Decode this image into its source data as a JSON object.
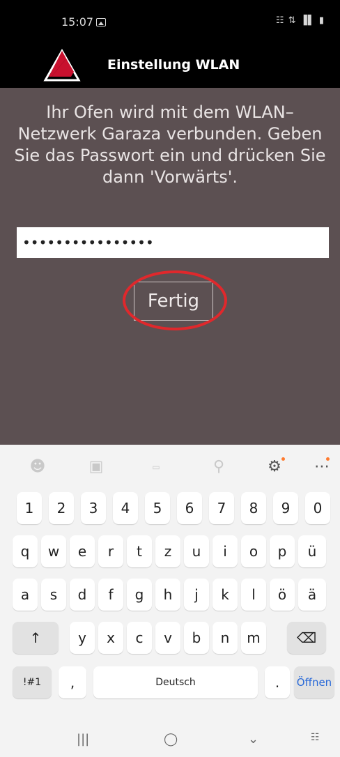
{
  "status_bar": {
    "time": "15:07",
    "system_icons": "☷ ⇅ ▐▌ ▮"
  },
  "header": {
    "title": "Einstellung WLAN"
  },
  "main": {
    "message": "Ihr Ofen wird mit dem WLAN–Netzwerk Garaza verbunden. Geben Sie das Passwort ein und drücken Sie dann 'Vorwärts'.",
    "password_value": "••••••••••••••••",
    "fertig_label": "Fertig",
    "highlight_color": "#e0282c"
  },
  "keyboard": {
    "toolbar_icons": [
      "emoji-icon",
      "sticker-icon",
      "gif-icon",
      "mic-icon",
      "gear-icon",
      "more-icon"
    ],
    "row_numbers": [
      "1",
      "2",
      "3",
      "4",
      "5",
      "6",
      "7",
      "8",
      "9",
      "0"
    ],
    "row_q": [
      "q",
      "w",
      "e",
      "r",
      "t",
      "z",
      "u",
      "i",
      "o",
      "p",
      "ü"
    ],
    "row_a": [
      "a",
      "s",
      "d",
      "f",
      "g",
      "h",
      "j",
      "k",
      "l",
      "ö",
      "ä"
    ],
    "row_y": [
      "y",
      "x",
      "c",
      "v",
      "b",
      "n",
      "m"
    ],
    "shift": "↑",
    "backspace": "⌫",
    "symbols": "!#1",
    "comma": ",",
    "space": "Deutsch",
    "period": ".",
    "enter": "Öffnen"
  },
  "navbar": {
    "recent": "|||",
    "home": "◯",
    "back": "⌄",
    "keyboard": "☷"
  }
}
